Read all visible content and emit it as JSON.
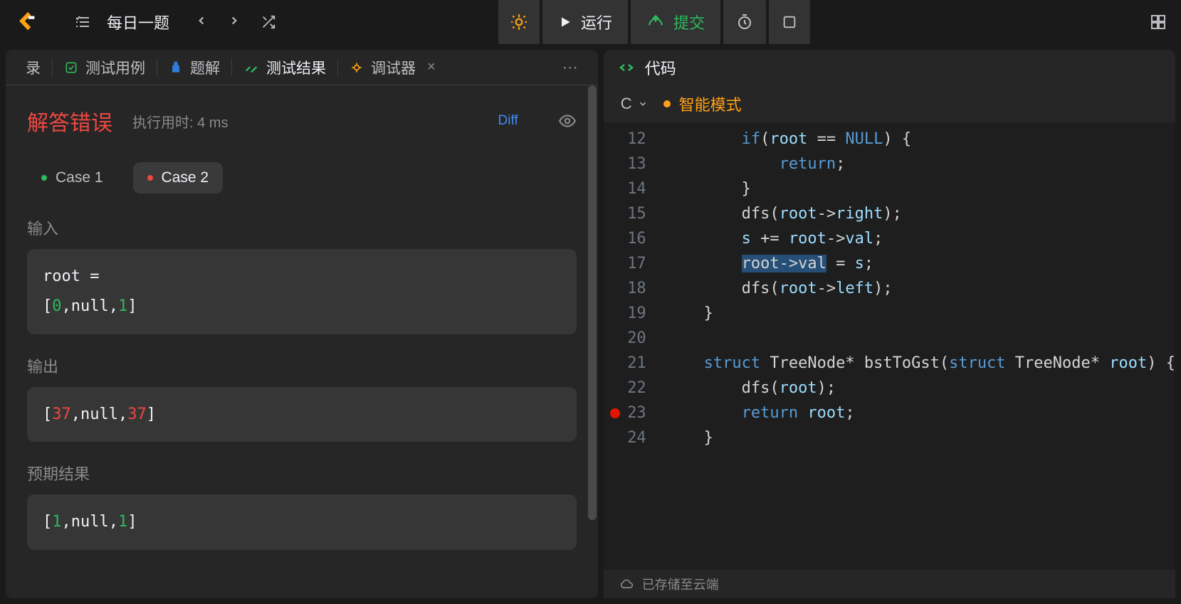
{
  "topbar": {
    "daily_label": "每日一题"
  },
  "actions": {
    "run": "运行",
    "submit": "提交"
  },
  "left_tabs": {
    "t0": "录",
    "t1": "测试用例",
    "t2": "题解",
    "t3": "测试结果",
    "t4": "调试器"
  },
  "result": {
    "error_title": "解答错误",
    "runtime": "执行用时: 4 ms",
    "diff": "Diff",
    "cases": {
      "c1": "Case 1",
      "c2": "Case 2"
    },
    "input_label": "输入",
    "input_name": "root =",
    "input_value": "[0,null,1]",
    "output_label": "输出",
    "output_value": [
      "[",
      "37",
      ",",
      "null",
      ",",
      "37",
      "]"
    ],
    "expected_label": "预期结果",
    "expected_value": [
      "[",
      "1",
      ",",
      "null",
      ",",
      "1",
      "]"
    ]
  },
  "code_panel": {
    "title": "代码",
    "language": "C",
    "mode": "智能模式",
    "status": "已存储至云端"
  },
  "code": {
    "lines": [
      {
        "n": 12,
        "t": [
          [
            "        ",
            ""
          ],
          [
            "if",
            "kw"
          ],
          [
            "(",
            ""
          ],
          [
            "root",
            "var"
          ],
          [
            " == ",
            ""
          ],
          [
            "NULL",
            "const"
          ],
          [
            ") {",
            ""
          ]
        ]
      },
      {
        "n": 13,
        "t": [
          [
            "            ",
            ""
          ],
          [
            "return",
            "kw"
          ],
          [
            ";",
            ""
          ]
        ]
      },
      {
        "n": 14,
        "t": [
          [
            "        }",
            ""
          ]
        ]
      },
      {
        "n": 15,
        "t": [
          [
            "        ",
            ""
          ],
          [
            "dfs",
            "fn"
          ],
          [
            "(",
            ""
          ],
          [
            "root",
            "var"
          ],
          [
            "->",
            "op"
          ],
          [
            "right",
            "var"
          ],
          [
            ");",
            ""
          ]
        ]
      },
      {
        "n": 16,
        "t": [
          [
            "        ",
            ""
          ],
          [
            "s",
            "var"
          ],
          [
            " += ",
            ""
          ],
          [
            "root",
            "var"
          ],
          [
            "->",
            "op"
          ],
          [
            "val",
            "var"
          ],
          [
            ";",
            ""
          ]
        ]
      },
      {
        "n": 17,
        "t": [
          [
            "        ",
            ""
          ],
          [
            "root->val",
            "sel"
          ],
          [
            " = ",
            ""
          ],
          [
            "s",
            "var"
          ],
          [
            ";",
            ""
          ]
        ]
      },
      {
        "n": 18,
        "t": [
          [
            "        ",
            ""
          ],
          [
            "dfs",
            "fn"
          ],
          [
            "(",
            ""
          ],
          [
            "root",
            "var"
          ],
          [
            "->",
            "op"
          ],
          [
            "left",
            "var"
          ],
          [
            ");",
            ""
          ]
        ]
      },
      {
        "n": 19,
        "t": [
          [
            "    }",
            ""
          ]
        ]
      },
      {
        "n": 20,
        "t": [
          [
            "",
            ""
          ]
        ]
      },
      {
        "n": 21,
        "t": [
          [
            "    ",
            ""
          ],
          [
            "struct",
            "kw"
          ],
          [
            " TreeNode* ",
            ""
          ],
          [
            "bstToGst",
            "fn"
          ],
          [
            "(",
            ""
          ],
          [
            "struct",
            "kw"
          ],
          [
            " TreeNode* ",
            ""
          ],
          [
            "root",
            "var"
          ],
          [
            ") {",
            ""
          ]
        ]
      },
      {
        "n": 22,
        "t": [
          [
            "        ",
            ""
          ],
          [
            "dfs",
            "fn"
          ],
          [
            "(",
            ""
          ],
          [
            "root",
            "var"
          ],
          [
            ");",
            ""
          ]
        ]
      },
      {
        "n": 23,
        "bp": true,
        "t": [
          [
            "        ",
            ""
          ],
          [
            "return",
            "kw"
          ],
          [
            " ",
            ""
          ],
          [
            "root",
            "var"
          ],
          [
            ";",
            ""
          ]
        ]
      },
      {
        "n": 24,
        "t": [
          [
            "    }",
            ""
          ]
        ]
      }
    ]
  }
}
